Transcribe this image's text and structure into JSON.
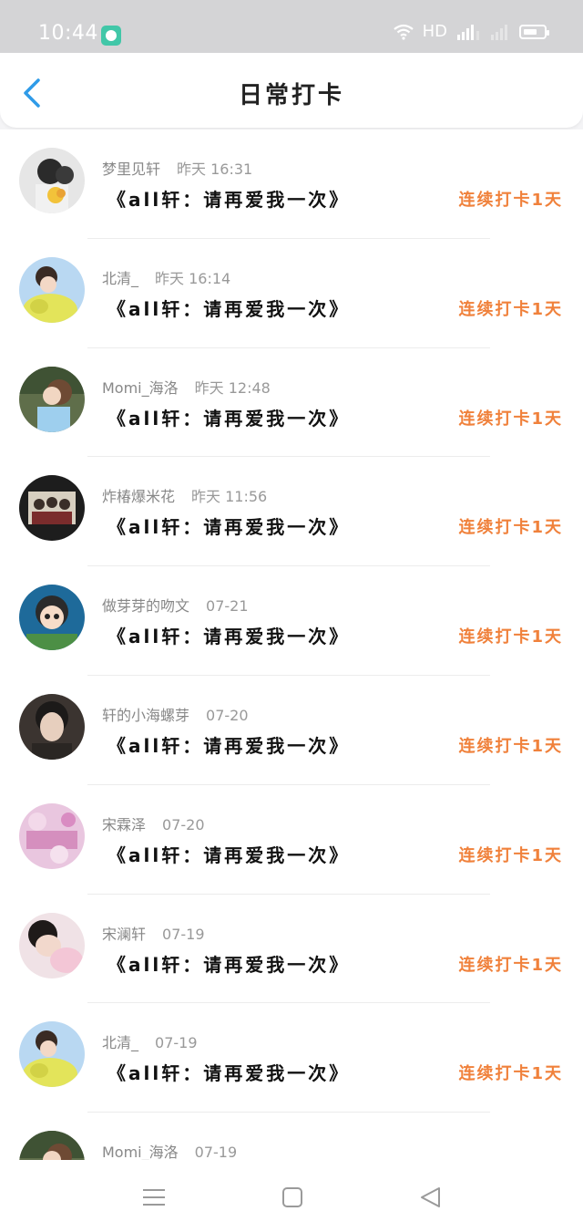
{
  "status_bar": {
    "time": "10:44",
    "network": "HD",
    "signal": "4G",
    "icons": [
      "app-notification-icon",
      "wifi-icon",
      "signal-icon",
      "battery-icon"
    ]
  },
  "header": {
    "title": "日常打卡",
    "back_icon": "back-icon"
  },
  "colors": {
    "streak": "#f0813b",
    "back": "#2f9be8",
    "app_badge": "#41c7a8"
  },
  "checkins": [
    {
      "user": "梦里见轩",
      "time": "昨天 16:31",
      "book": "《all轩：请再爱我一次》",
      "streak": "连续打卡1天"
    },
    {
      "user": "北清_",
      "time": "昨天 16:14",
      "book": "《all轩：请再爱我一次》",
      "streak": "连续打卡1天"
    },
    {
      "user": "Momi_海洛",
      "time": "昨天 12:48",
      "book": "《all轩：请再爱我一次》",
      "streak": "连续打卡1天"
    },
    {
      "user": "炸椿爆米花",
      "time": "昨天 11:56",
      "book": "《all轩：请再爱我一次》",
      "streak": "连续打卡1天"
    },
    {
      "user": "做芽芽的吻文",
      "time": "07-21",
      "book": "《all轩：请再爱我一次》",
      "streak": "连续打卡1天"
    },
    {
      "user": "轩的小海螺芽",
      "time": "07-20",
      "book": "《all轩：请再爱我一次》",
      "streak": "连续打卡1天"
    },
    {
      "user": "宋霖泽",
      "time": "07-20",
      "book": "《all轩：请再爱我一次》",
      "streak": "连续打卡1天"
    },
    {
      "user": "宋澜轩",
      "time": "07-19",
      "book": "《all轩：请再爱我一次》",
      "streak": "连续打卡1天"
    },
    {
      "user": "北清_",
      "time": "07-19",
      "book": "《all轩：请再爱我一次》",
      "streak": "连续打卡1天"
    },
    {
      "user": "Momi_海洛",
      "time": "07-19"
    }
  ],
  "bottom_nav": [
    "menu-icon",
    "home-icon",
    "back-triangle-icon"
  ]
}
